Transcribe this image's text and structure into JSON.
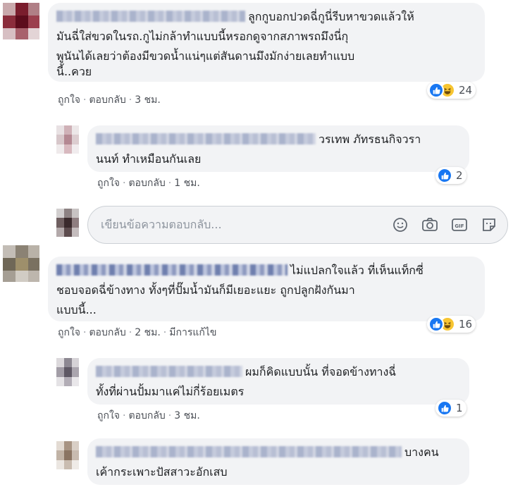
{
  "comments": [
    {
      "text": "ลูกกูบอกปวดฉี่กูนี่รีบหาขวดแล้วให้มันฉี่ใส่ขวดในรถ.กูไม่กล้าทำแบบนี้หรอกดูจากสภาพรถมึงนี่กุพูนันได้เลยว่าต้องมีขวดน้ำแน่ๆแต่สันดานมึงมักง่ายเลยทำแบบนี้..ควย",
      "lines": [
        "ลูกกูบอกปวดฉี่กูนี่รีบหาขวดแล้วให้",
        "มันฉี่ใส่ขวดในรถ.กูไม่กล้าทำแบบนี้หรอกดูจากสภาพรถมึงนี่กุ",
        "พูนันได้เลยว่าต้องมีขวดน้ำแน่ๆแต่สันดานมึงมักง่ายเลยทำแบบ",
        "นี้..ควย"
      ],
      "like": "ถูกใจ",
      "reply": "ตอบกลับ",
      "time": "3 ชม.",
      "reactions": "24"
    },
    {
      "lines": [
        "วรเทพ ภัทรธนกิจวรา",
        "นนท์ ทำเหมือนกันเลย"
      ],
      "like": "ถูกใจ",
      "reply": "ตอบกลับ",
      "time": "1 ชม.",
      "reactions": "2"
    },
    {
      "lines": [
        "ไม่แปลกใจแล้ว ที่เห็นแท็กซี่",
        "ชอบจอดฉี่ข้างทาง ทั้งๆที่ปั๊มน้ำมันก็มีเยอะแยะ ถูกปลูกฝังกันมา",
        "แบบนี้..."
      ],
      "like": "ถูกใจ",
      "reply": "ตอบกลับ",
      "time": "2 ชม.",
      "edited": "มีการแก้ไข",
      "reactions": "16"
    },
    {
      "lines": [
        "ผมก็คิดแบบนั้น ที่จอดข้างทางฉี่",
        "ทั้งที่ผ่านปั้มมาแค่ไม่กี่ร้อยเมตร"
      ],
      "like": "ถูกใจ",
      "reply": "ตอบกลับ",
      "time": "3 ชม.",
      "reactions": "1"
    },
    {
      "lines": [
        "บางคน",
        "เค้ากระเพาะปัสสาวะอักเสบ"
      ]
    }
  ],
  "reply_box": {
    "placeholder": "เขียนข้อความตอบกลับ...",
    "icons": [
      "emoji-icon",
      "camera-icon",
      "gif-icon",
      "sticker-icon"
    ]
  },
  "colors": {
    "like_blue": "#1877f2",
    "haha_yellow": "#f7c531",
    "bubble_bg": "#f2f3f5"
  }
}
